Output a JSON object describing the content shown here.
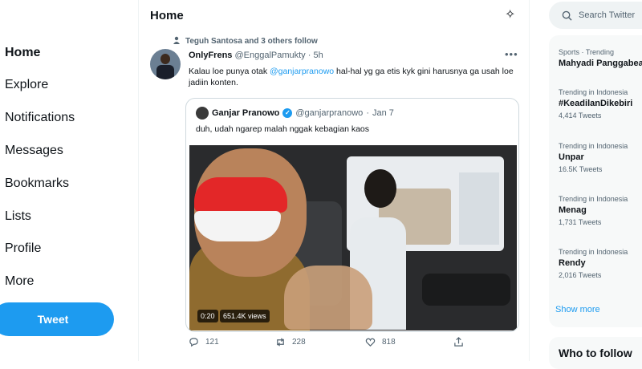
{
  "nav": {
    "items": [
      "Home",
      "Explore",
      "Notifications",
      "Messages",
      "Bookmarks",
      "Lists",
      "Profile",
      "More"
    ],
    "tweet_button": "Tweet"
  },
  "feed": {
    "title": "Home",
    "tweet": {
      "social_context": "Teguh Santosa and 3 others follow",
      "author_name": "OnlyFrens",
      "author_handle": "@EnggalPamukty",
      "time": "5h",
      "text_before": "Kalau loe punya otak ",
      "mention": "@ganjarpranowo",
      "text_after": " hal-hal yg ga etis kyk gini harusnya ga usah loe jadiin konten.",
      "quote": {
        "name": "Ganjar Pranowo",
        "handle": "@ganjarpranowo",
        "date": "Jan 7",
        "text": "duh, udah ngarep malah nggak kebagian kaos",
        "video_time": "0:20",
        "video_views": "651.4K views"
      },
      "stats": {
        "replies": "121",
        "retweets": "228",
        "likes": "818"
      }
    }
  },
  "right": {
    "search_placeholder": "Search Twitter",
    "trends": [
      {
        "context": "Sports · Trending",
        "name": "Mahyadi Panggabean",
        "count": ""
      },
      {
        "context": "Trending in Indonesia",
        "name": "#KeadilanDikebiri",
        "count": "4,414 Tweets"
      },
      {
        "context": "Trending in Indonesia",
        "name": "Unpar",
        "count": "16.5K Tweets"
      },
      {
        "context": "Trending in Indonesia",
        "name": "Menag",
        "count": "1,731 Tweets"
      },
      {
        "context": "Trending in Indonesia",
        "name": "Rendy",
        "count": "2,016 Tweets"
      }
    ],
    "show_more": "Show more",
    "who_to_follow": "Who to follow"
  },
  "colors": {
    "accent": "#1d9bf0",
    "text": "#0f1419",
    "muted": "#536471"
  }
}
